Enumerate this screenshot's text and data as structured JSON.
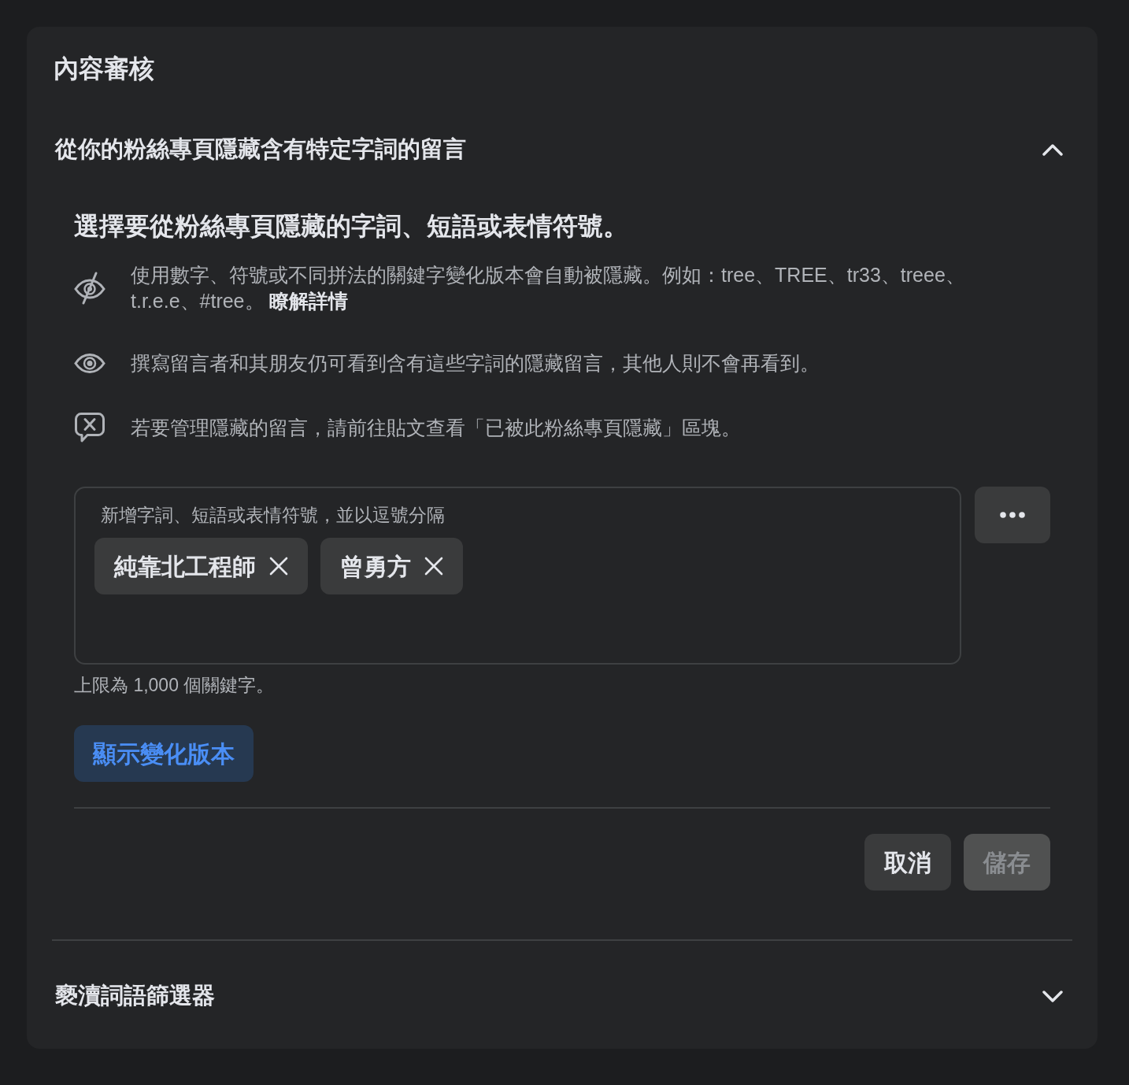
{
  "page": {
    "title": "內容審核"
  },
  "sections": [
    {
      "title": "從你的粉絲專頁隱藏含有特定字詞的留言",
      "expanded": true,
      "heading": "選擇要從粉絲專頁隱藏的字詞、短語或表情符號。",
      "info": [
        {
          "kind": "variants",
          "text": "使用數字、符號或不同拼法的關鍵字變化版本會自動被隱藏。例如：tree、TREE、tr33、treee、t.r.e.e、#tree。",
          "link": "瞭解詳情"
        },
        {
          "kind": "visibility",
          "text": "撰寫留言者和其朋友仍可看到含有這些字詞的隱藏留言，其他人則不會再看到。"
        },
        {
          "kind": "manage",
          "text": "若要管理隱藏的留言，請前往貼文查看「已被此粉絲專頁隱藏」區塊。"
        }
      ],
      "keyword_field": {
        "label": "新增字詞、短語或表情符號，並以逗號分隔",
        "tags": [
          {
            "text": "純靠北工程師"
          },
          {
            "text": "曾勇方"
          }
        ]
      },
      "limit_hint": "上限為 1,000 個關鍵字。",
      "variations_button": "顯示變化版本",
      "actions": [
        {
          "label": "取消",
          "kind": "secondary",
          "disabled": false
        },
        {
          "label": "儲存",
          "kind": "primary",
          "disabled": true
        }
      ]
    },
    {
      "title": "褻瀆詞語篩選器",
      "expanded": false
    }
  ]
}
